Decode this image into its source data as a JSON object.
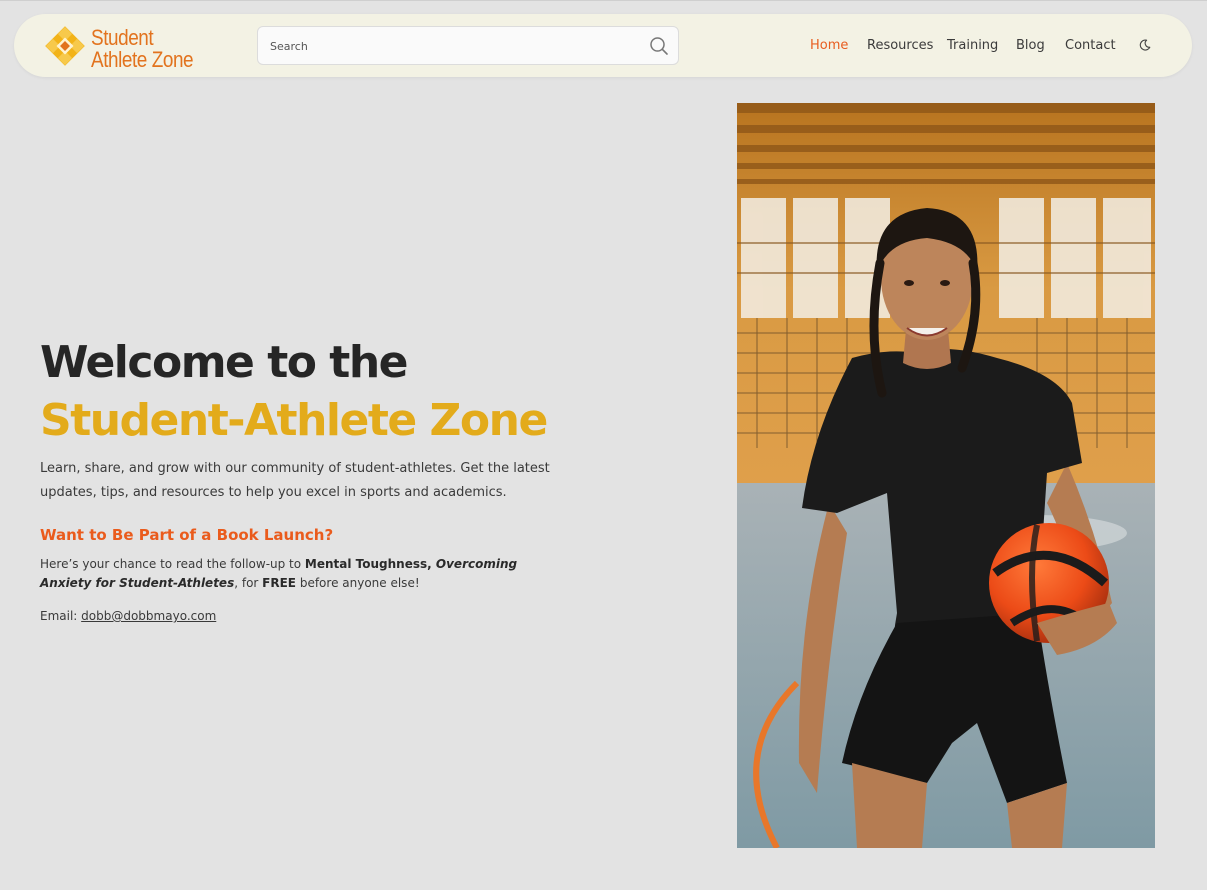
{
  "logo": {
    "line1": "Student",
    "line2": "Athlete Zone"
  },
  "search": {
    "placeholder": "Search"
  },
  "nav": {
    "items": [
      {
        "label": "Home",
        "active": true
      },
      {
        "label": "Resources",
        "active": false
      },
      {
        "label": "Training",
        "active": false
      },
      {
        "label": "Blog",
        "active": false
      },
      {
        "label": "Contact",
        "active": false
      }
    ],
    "theme_toggle_icon": "moon-icon"
  },
  "hero": {
    "title_line1": "Welcome to the",
    "title_line2": "Student-Athlete Zone",
    "intro": "Learn, share, and grow with our community of student-athletes. Get the latest updates, tips, and resources to help you excel in sports and academics.",
    "promo_heading": "Want to Be Part of a Book Launch?",
    "promo": {
      "part1": "Here’s your chance to read the follow-up to ",
      "book_title": "Mental Toughness",
      "sep": ", ",
      "subtitle": "Overcoming Anxiety for Student-Athletes",
      "part2": ", for ",
      "free": "FREE",
      "part3": " before anyone else!"
    },
    "email_label": "Email: ",
    "email": "dobb@dobbmayo.com"
  },
  "colors": {
    "accent_orange": "#e85d1f",
    "accent_gold": "#e3ab1b",
    "header_bg": "#f3f2e4",
    "page_bg": "#e3e3e3"
  }
}
